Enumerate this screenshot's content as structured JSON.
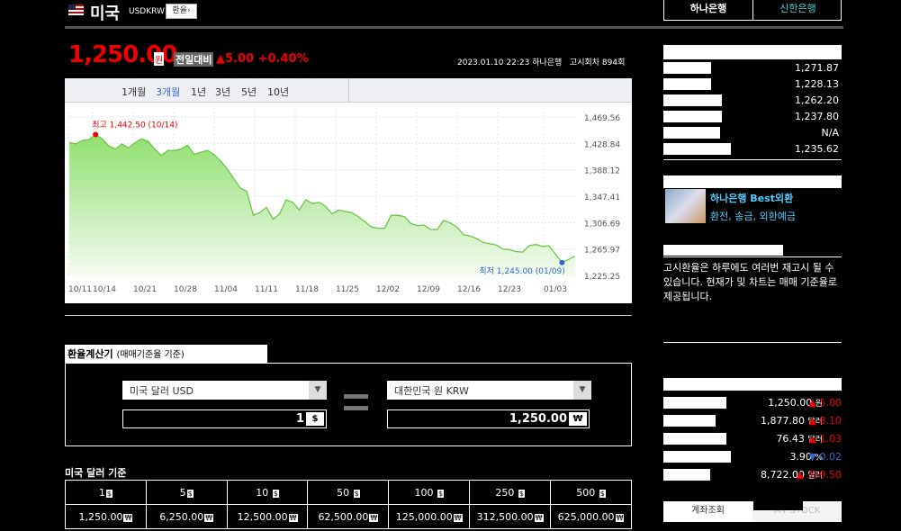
{
  "header": {
    "country": "미국",
    "code": "USDKRW",
    "exchange_button": "환율",
    "price": "1,250.00",
    "price_unit": "원",
    "compare_label": "전일대비",
    "change": "▲5.00",
    "change_pct": "+0.40%",
    "datetime": "2023.01.10 22:23",
    "bank": "하나은행",
    "notice": "고시회차 894회"
  },
  "chart": {
    "tabs": [
      "1개월",
      "3개월",
      "1년",
      "3년",
      "5년",
      "10년"
    ],
    "active_tab": "3개월",
    "high_label": "최고 1,442.50 (10/14)",
    "low_label": "최저 1,245.00 (01/09)"
  },
  "chart_data": {
    "type": "area",
    "x_tick_labels": [
      "10/11",
      "10/14",
      "10/21",
      "10/28",
      "11/04",
      "11/11",
      "11/18",
      "11/25",
      "12/02",
      "12/09",
      "12/16",
      "12/23",
      "01/03"
    ],
    "y_tick_labels": [
      "1,469.56",
      "1,428.84",
      "1,388.12",
      "1,347.41",
      "1,306.69",
      "1,265.97",
      "1,225.25"
    ],
    "ylim": [
      1225.25,
      1469.56
    ],
    "values": [
      1430,
      1428,
      1433,
      1435,
      1442.5,
      1436,
      1425,
      1420,
      1428,
      1422,
      1430,
      1436,
      1432,
      1420,
      1410,
      1418,
      1418,
      1420,
      1426,
      1412,
      1415,
      1418,
      1412,
      1402,
      1390,
      1375,
      1360,
      1355,
      1318,
      1322,
      1330,
      1312,
      1320,
      1342,
      1338,
      1326,
      1342,
      1336,
      1338,
      1332,
      1320,
      1326,
      1324,
      1322,
      1316,
      1308,
      1300,
      1298,
      1298,
      1318,
      1318,
      1316,
      1305,
      1302,
      1303,
      1296,
      1296,
      1310,
      1306,
      1300,
      1288,
      1286,
      1282,
      1276,
      1274,
      1272,
      1266,
      1265,
      1262,
      1261,
      1271,
      1273,
      1270,
      1271,
      1258,
      1245,
      1250,
      1255
    ],
    "grid": true
  },
  "calculator": {
    "title": "환율계산기",
    "subtitle": "(매매기준율 기준)",
    "from_currency": "미국 달러 USD",
    "to_currency": "대한민국 원 KRW",
    "from_amount": "1",
    "from_unit": "$",
    "to_amount": "1,250.00",
    "to_unit": "₩"
  },
  "table": {
    "title": "미국 달러 기준",
    "headers": [
      "1",
      "5",
      "10",
      "50",
      "100",
      "250",
      "500"
    ],
    "header_unit": "$",
    "values": [
      "1,250.00",
      "6,250.00",
      "12,500.00",
      "62,500.00",
      "125,000.00",
      "312,500.00",
      "625,000.00"
    ],
    "value_unit": "₩"
  },
  "right": {
    "tab1": "하나은행",
    "tab2": "신한은행",
    "rates": [
      "1,271.87",
      "1,228.13",
      "1,262.20",
      "1,237.80",
      "N/A",
      "1,235.62"
    ],
    "banner_title": "하나은행 Best외환",
    "banner_sub": "환전, 송금, 외환예금",
    "note": "고시환율은 하루에도 여러번 재고시 될 수 있습니다. 현재가 및 차트는 매매 기준율로 제공됩니다.",
    "markets": [
      {
        "value": "1,250.00",
        "unit": "원",
        "change": "▲ 5.00",
        "dir": "up"
      },
      {
        "value": "1,877.80",
        "unit": "달러",
        "change": "▲ 8.10",
        "dir": "up"
      },
      {
        "value": "76.43",
        "unit": "달러",
        "change": "▲ 1.03",
        "dir": "up"
      },
      {
        "value": "3.90",
        "unit": "%",
        "change": "▼ 0.02",
        "dir": "dn"
      },
      {
        "value": "8,722.00",
        "unit": "달러",
        "change": "▲ 359.50",
        "dir": "up"
      }
    ],
    "bottom_tab1": "계좌조회",
    "bottom_tab2": "MY STOCK"
  }
}
